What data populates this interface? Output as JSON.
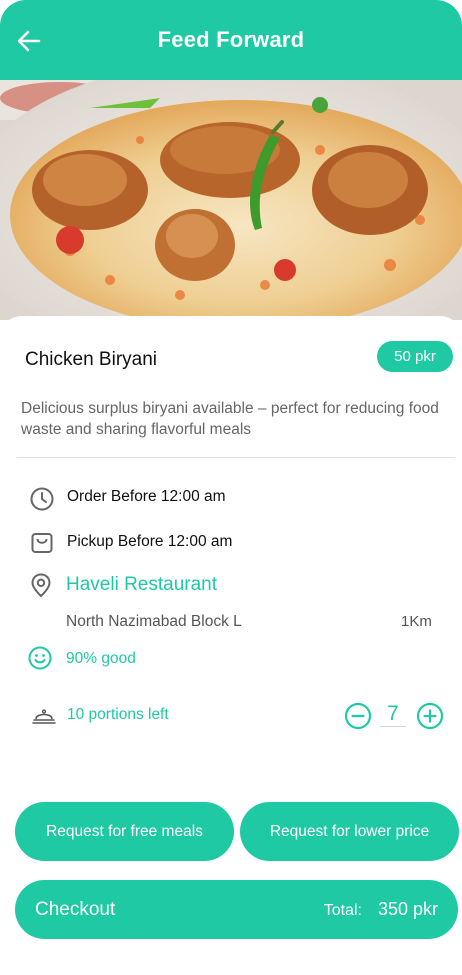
{
  "header": {
    "title": "Feed Forward",
    "back_icon": "arrow-left-icon"
  },
  "hero": {
    "image": "chicken-biryani-plate"
  },
  "item": {
    "name": "Chicken Biryani",
    "price": "50 pkr",
    "description": "Delicious surplus biryani available – perfect for reducing food waste and sharing flavorful meals"
  },
  "details": {
    "order_before": "Order Before 12:00 am",
    "pickup_before": "Pickup Before 12:00 am",
    "restaurant": "Haveli Restaurant",
    "address": "North Nazimabad  Block L",
    "distance": "1Km",
    "rating": "90% good",
    "portions_left": "10 portions left"
  },
  "quantity": {
    "value": "7"
  },
  "actions": {
    "free_meals": "Request for free meals",
    "lower_price": "Request for lower price",
    "checkout": "Checkout",
    "total_label": "Total:",
    "total_value": "350 pkr"
  },
  "colors": {
    "accent": "#1ec9a4",
    "text_muted": "#666666"
  }
}
